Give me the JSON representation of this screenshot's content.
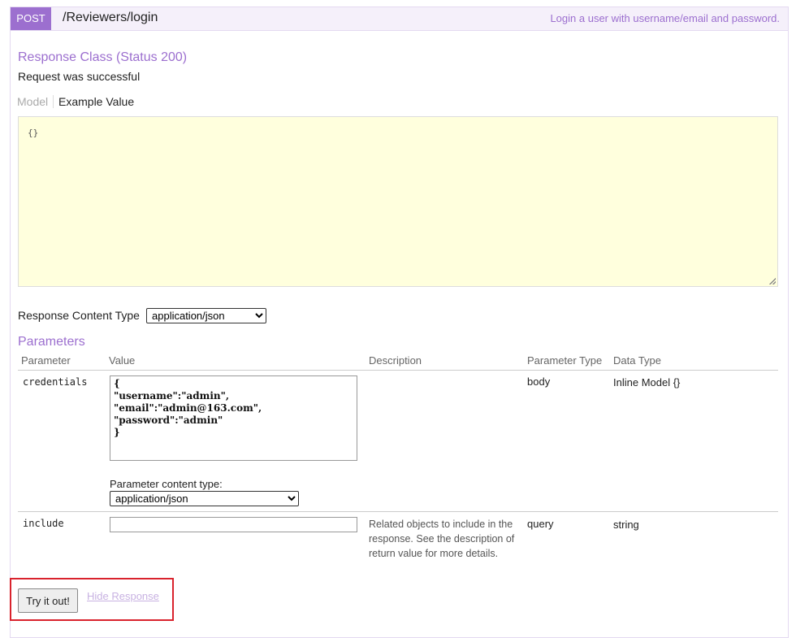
{
  "operation": {
    "method": "POST",
    "path": "/Reviewers/login",
    "summary": "Login a user with username/email and password."
  },
  "response_class": {
    "heading": "Response Class (Status 200)",
    "message": "Request was successful",
    "tabs": [
      "Model",
      "Example Value"
    ],
    "example_value": "{}"
  },
  "response_content_type": {
    "label": "Response Content Type",
    "value": "application/json"
  },
  "parameters": {
    "heading": "Parameters",
    "columns": [
      "Parameter",
      "Value",
      "Description",
      "Parameter Type",
      "Data Type"
    ],
    "rows": [
      {
        "name": "credentials",
        "value": "{\n\"username\":\"admin\",\n\"email\":\"admin@163.com\",\n\"password\":\"admin\"\n}",
        "content_type_label": "Parameter content type:",
        "content_type": "application/json",
        "description": "",
        "param_type": "body",
        "data_type": "Inline Model {}"
      },
      {
        "name": "include",
        "value": "",
        "description": "Related objects to include in the response. See the description of return value for more details.",
        "param_type": "query",
        "data_type": "string"
      }
    ]
  },
  "actions": {
    "try_label": "Try it out!",
    "hide_label": "Hide Response"
  },
  "colors": {
    "accent": "#9c6fcf",
    "header_bg": "#f5f0fa",
    "snippet_bg": "#ffffdd",
    "highlight": "#d9232d"
  }
}
